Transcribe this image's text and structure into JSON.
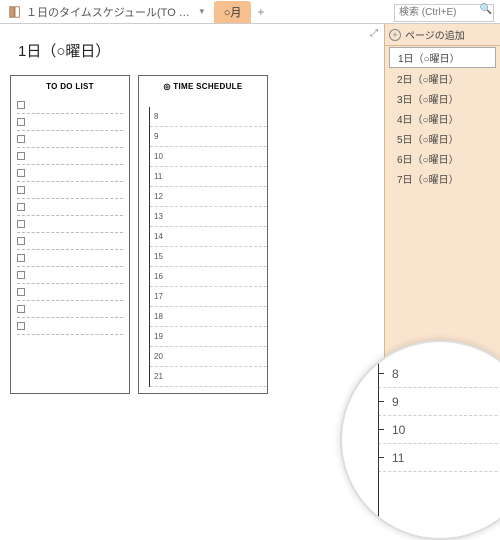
{
  "tabs": {
    "main_title": "１日のタイムスケジュール(TO …",
    "sub_tab": "○月",
    "add": "+"
  },
  "search": {
    "placeholder": "検索 (Ctrl+E)"
  },
  "page": {
    "title": "1日（○曜日）"
  },
  "todo": {
    "heading": "TO DO LIST",
    "count": 14
  },
  "schedule": {
    "heading": "◎ TIME SCHEDULE",
    "hours": [
      "8",
      "9",
      "10",
      "11",
      "12",
      "13",
      "14",
      "15",
      "16",
      "17",
      "18",
      "19",
      "20",
      "21"
    ]
  },
  "sidebar": {
    "add_label": "ページの追加",
    "items": [
      "1日（○曜日）",
      "2日（○曜日）",
      "3日（○曜日）",
      "4日（○曜日）",
      "5日（○曜日）",
      "6日（○曜日）",
      "7日（○曜日）"
    ],
    "selected": 0
  },
  "zoom": {
    "hours": [
      "8",
      "9",
      "10",
      "11"
    ]
  }
}
